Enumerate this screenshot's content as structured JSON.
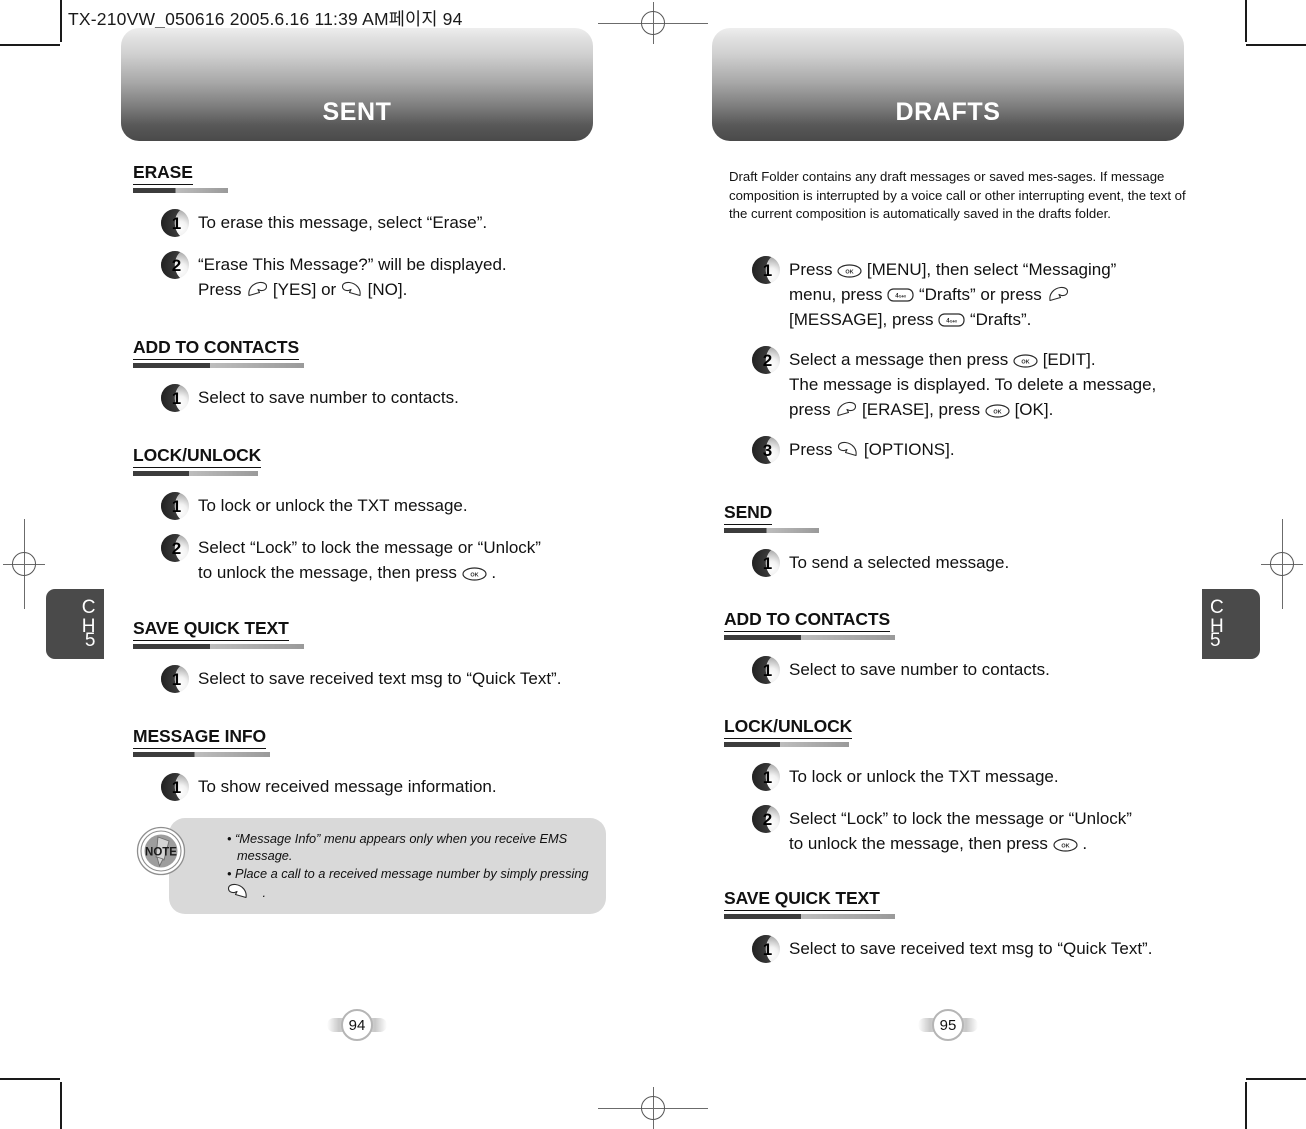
{
  "doc_meta": "TX-210VW_050616  2005.6.16 11:39 AM페이지 94",
  "chapter_tab": {
    "line1": "C",
    "line2": "H",
    "number": "5"
  },
  "left_page": {
    "banner_title": "SENT",
    "page_number": "94",
    "sections": [
      {
        "title": "ERASE",
        "steps": [
          {
            "num": "1",
            "parts": [
              {
                "t": "text",
                "v": "To erase this message, select “Erase”."
              }
            ]
          },
          {
            "num": "2",
            "parts": [
              {
                "t": "text",
                "v": "“Erase This Message?” will be displayed."
              },
              {
                "t": "br"
              },
              {
                "t": "text",
                "v": "Press "
              },
              {
                "t": "icon",
                "v": "send-key-icon"
              },
              {
                "t": "text",
                "v": " [YES] or "
              },
              {
                "t": "icon",
                "v": "end-key-icon"
              },
              {
                "t": "text",
                "v": " [NO]."
              }
            ]
          }
        ]
      },
      {
        "title": "ADD TO CONTACTS",
        "steps": [
          {
            "num": "1",
            "parts": [
              {
                "t": "text",
                "v": "Select to save number to contacts."
              }
            ]
          }
        ]
      },
      {
        "title": "LOCK/UNLOCK",
        "steps": [
          {
            "num": "1",
            "parts": [
              {
                "t": "text",
                "v": "To lock or unlock the TXT message."
              }
            ]
          },
          {
            "num": "2",
            "parts": [
              {
                "t": "text",
                "v": "Select “Lock” to lock the message or “Unlock”"
              },
              {
                "t": "br"
              },
              {
                "t": "text",
                "v": "to unlock the message, then press "
              },
              {
                "t": "icon",
                "v": "ok-key-icon"
              },
              {
                "t": "text",
                "v": " ."
              }
            ]
          }
        ]
      },
      {
        "title": "SAVE QUICK TEXT",
        "steps": [
          {
            "num": "1",
            "parts": [
              {
                "t": "text",
                "v": "Select to save received text msg to “Quick Text”."
              }
            ]
          }
        ]
      },
      {
        "title": "MESSAGE INFO",
        "steps": [
          {
            "num": "1",
            "parts": [
              {
                "t": "text",
                "v": "To show received message information."
              }
            ]
          }
        ]
      }
    ],
    "note": {
      "label": "NOTE",
      "bullets": [
        {
          "parts": [
            {
              "t": "text",
              "v": "“Message Info” menu appears only when you receive EMS message."
            }
          ]
        },
        {
          "parts": [
            {
              "t": "text",
              "v": "Place a call to a received message number by simply pressing "
            },
            {
              "t": "icon",
              "v": "end-key-icon"
            },
            {
              "t": "text",
              "v": " ."
            }
          ]
        }
      ]
    }
  },
  "right_page": {
    "banner_title": "DRAFTS",
    "page_number": "95",
    "intro": "Draft Folder contains any draft messages or saved mes-sages. If message composition is interrupted by a voice call or other interrupting event, the text of the current composition is automatically saved in the drafts folder.",
    "sections": [
      {
        "title": "",
        "steps": [
          {
            "num": "1",
            "parts": [
              {
                "t": "text",
                "v": "Press "
              },
              {
                "t": "icon",
                "v": "ok-key-icon"
              },
              {
                "t": "text",
                "v": " [MENU], then select “Messaging”"
              },
              {
                "t": "br"
              },
              {
                "t": "text",
                "v": "menu, press "
              },
              {
                "t": "icon",
                "v": "num4-key-icon"
              },
              {
                "t": "text",
                "v": " “Drafts” or press "
              },
              {
                "t": "icon",
                "v": "send-key-icon"
              },
              {
                "t": "br"
              },
              {
                "t": "text",
                "v": "[MESSAGE], press "
              },
              {
                "t": "icon",
                "v": "num4-key-icon"
              },
              {
                "t": "text",
                "v": " “Drafts”."
              }
            ]
          },
          {
            "num": "2",
            "parts": [
              {
                "t": "text",
                "v": "Select a message then press "
              },
              {
                "t": "icon",
                "v": "ok-key-icon"
              },
              {
                "t": "text",
                "v": " [EDIT]."
              },
              {
                "t": "br"
              },
              {
                "t": "text",
                "v": "The message is displayed. To delete a message,"
              },
              {
                "t": "br"
              },
              {
                "t": "text",
                "v": "press "
              },
              {
                "t": "icon",
                "v": "send-key-icon"
              },
              {
                "t": "text",
                "v": " [ERASE], press "
              },
              {
                "t": "icon",
                "v": "ok-key-icon"
              },
              {
                "t": "text",
                "v": " [OK]."
              }
            ]
          },
          {
            "num": "3",
            "parts": [
              {
                "t": "text",
                "v": "Press "
              },
              {
                "t": "icon",
                "v": "end-key-icon"
              },
              {
                "t": "text",
                "v": " [OPTIONS]."
              }
            ]
          }
        ]
      },
      {
        "title": "SEND",
        "steps": [
          {
            "num": "1",
            "parts": [
              {
                "t": "text",
                "v": "To send a selected message."
              }
            ]
          }
        ]
      },
      {
        "title": "ADD TO CONTACTS",
        "steps": [
          {
            "num": "1",
            "parts": [
              {
                "t": "text",
                "v": "Select to save number to contacts."
              }
            ]
          }
        ]
      },
      {
        "title": "LOCK/UNLOCK",
        "steps": [
          {
            "num": "1",
            "parts": [
              {
                "t": "text",
                "v": "To lock or unlock the TXT message."
              }
            ]
          },
          {
            "num": "2",
            "parts": [
              {
                "t": "text",
                "v": "Select “Lock” to lock the message or “Unlock”"
              },
              {
                "t": "br"
              },
              {
                "t": "text",
                "v": "to unlock the message, then press "
              },
              {
                "t": "icon",
                "v": "ok-key-icon"
              },
              {
                "t": "text",
                "v": " ."
              }
            ]
          }
        ]
      },
      {
        "title": "SAVE QUICK TEXT",
        "steps": [
          {
            "num": "1",
            "parts": [
              {
                "t": "text",
                "v": "Select to save received text msg to “Quick Text”."
              }
            ]
          }
        ]
      }
    ]
  },
  "icons": {
    "ok-key-icon": "OK",
    "num4-key-icon": "4GHI",
    "send-key-icon": "send",
    "end-key-icon": "end"
  },
  "colors": {
    "banner_top": "#eeeeee",
    "banner_bottom": "#4a4a4a",
    "tab_bg": "#4a4a4a",
    "rule_dark": "#3c3c3c",
    "rule_light": "#9a9a9a",
    "note_bg": "#d9d9d9",
    "text": "#111111"
  }
}
